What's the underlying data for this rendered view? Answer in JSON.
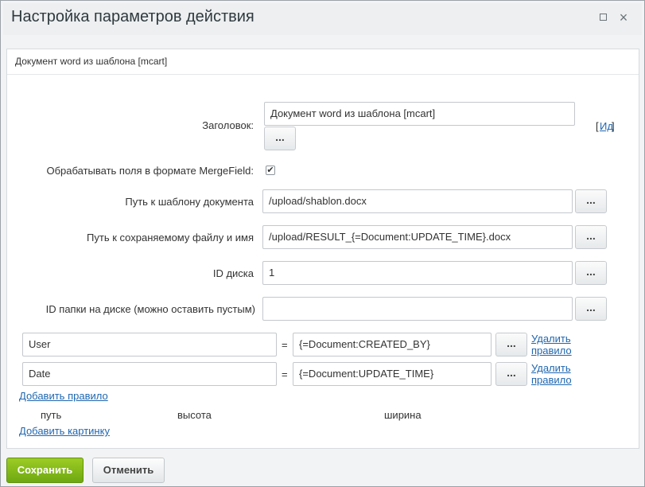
{
  "window": {
    "title": "Настройка параметров действия",
    "maximize_icon": "maximize-icon",
    "close_icon": "close-icon",
    "close_glyph": "×"
  },
  "subtitle": "Документ word из шаблона [mcart]",
  "form": {
    "heading": {
      "label": "Заголовок:",
      "value": "Документ word из шаблона [mcart]",
      "dots": "...",
      "id_prefix": "[",
      "id_link": "Ид",
      "id_suffix": "]"
    },
    "mergefield": {
      "label": "Обрабатывать поля в формате MergeField:",
      "checked": true,
      "check_glyph": "✔"
    },
    "template_path": {
      "label": "Путь к шаблону документа",
      "value": "/upload/shablon.docx",
      "dots": "..."
    },
    "save_path": {
      "label": "Путь к сохраняемому файлу и имя",
      "value": "/upload/RESULT_{=Document:UPDATE_TIME}.docx",
      "dots": "..."
    },
    "disk_id": {
      "label": "ID диска",
      "value": "1",
      "dots": "..."
    },
    "folder_id": {
      "label": "ID папки на диске (можно оставить пустым)",
      "value": "",
      "dots": "..."
    }
  },
  "rules": [
    {
      "name": "User",
      "eq": "=",
      "value": "{=Document:CREATED_BY}",
      "dots": "...",
      "delete_line1": "Удалить",
      "delete_line2": "правило"
    },
    {
      "name": "Date",
      "eq": "=",
      "value": "{=Document:UPDATE_TIME}",
      "dots": "...",
      "delete_line1": "Удалить",
      "delete_line2": "правило"
    }
  ],
  "add_rule": "Добавить правило",
  "image_columns": {
    "path": "путь",
    "height": "высота",
    "width": "ширина"
  },
  "add_image": "Добавить картинку",
  "footer": {
    "save": "Сохранить",
    "cancel": "Отменить"
  },
  "colors": {
    "save_button": "#7ab317",
    "link": "#2067b0"
  }
}
